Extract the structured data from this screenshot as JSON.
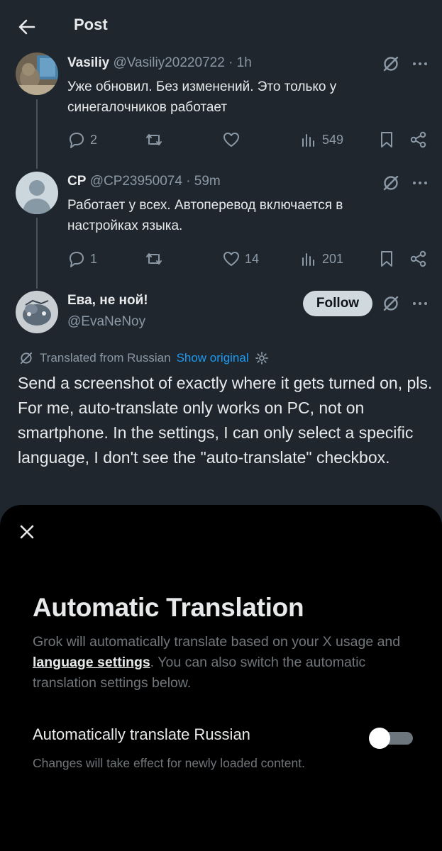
{
  "header": {
    "title": "Post"
  },
  "posts": [
    {
      "name": "Vasiliy",
      "handle": "@Vasiliy20220722",
      "time": "· 1h",
      "text": "Уже обновил. Без изменений. Это только у синегалочников работает",
      "replies": "2",
      "reposts": "",
      "likes": "",
      "views": "549"
    },
    {
      "name": "CP",
      "handle": "@CP23950074",
      "time": "· 59m",
      "text": "Работает у всех. Автоперевод включается в настройках языка.",
      "replies": "1",
      "reposts": "",
      "likes": "14",
      "views": "201"
    }
  ],
  "main_post": {
    "name": "Ева, не ной!",
    "handle": "@EvaNeNoy",
    "follow_label": "Follow",
    "translated_label": "Translated from Russian",
    "show_original_label": "Show original",
    "text": "Send a screenshot of exactly where it gets turned on, pls. For me, auto-translate only works on PC, not on smartphone. In the settings, I can only select a specific language, I don't see the \"auto-translate\" checkbox."
  },
  "sheet": {
    "title": "Automatic Translation",
    "desc_before": "Grok will automatically translate based on your X usage and ",
    "link_text": "language settings",
    "desc_after": ". You can also switch the automatic translation settings below.",
    "toggle_label": "Automatically translate Russian",
    "toggle_state": "off",
    "note": "Changes will take effect for newly loaded content."
  },
  "icons": [
    "back-arrow-icon",
    "grok-icon",
    "more-icon",
    "reply-icon",
    "repost-icon",
    "like-icon",
    "views-icon",
    "bookmark-icon",
    "share-icon",
    "close-icon",
    "settings-gear-icon"
  ],
  "colors": {
    "background": "#1f262e",
    "sheet": "#000000",
    "link": "#1d9bf0",
    "muted": "#8b98a5"
  }
}
